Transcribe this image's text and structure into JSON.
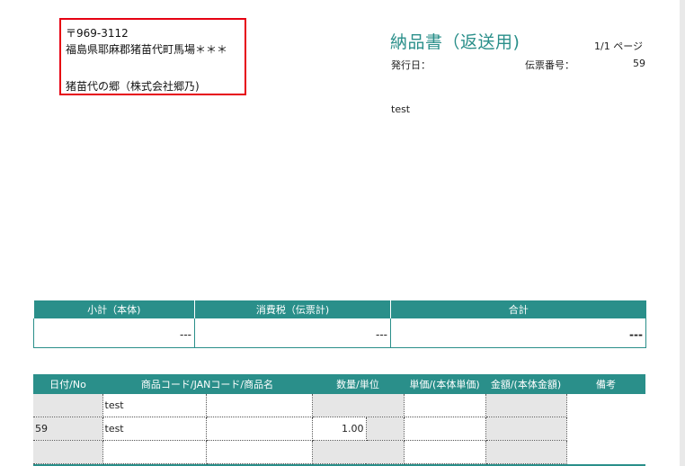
{
  "sender": {
    "postal": "〒969-3112",
    "address": "福島県耶麻郡猪苗代町馬場＊＊＊",
    "company": "猪苗代の郷（株式会社郷乃)"
  },
  "doc": {
    "title": "納品書（返送用)",
    "page_indicator": "1/1 ページ",
    "issue_date_label": "発行日：",
    "issue_date_value": "",
    "slip_number_label": "伝票番号：",
    "slip_number_value": "59",
    "note": "test"
  },
  "summary": {
    "headers": [
      "小計（本体)",
      "消費税（伝票計)",
      "合計"
    ],
    "values": [
      "---",
      "---",
      "---"
    ]
  },
  "items": {
    "headers": [
      "日付/No",
      "商品コード/JANコード/商品名",
      "数量/単位",
      "単価/(本体単価)",
      "金額/(本体金額)",
      "備考"
    ],
    "rows": [
      {
        "date_no": "",
        "code": "test",
        "name": "",
        "qty": "",
        "unit": "",
        "price": "",
        "amount": ""
      },
      {
        "date_no": "59",
        "code": "test",
        "name": "",
        "qty": "1.00",
        "unit": "",
        "price": "",
        "amount": ""
      },
      {
        "date_no": "",
        "code": "",
        "name": "",
        "qty": "",
        "unit": "",
        "price": "",
        "amount": ""
      }
    ]
  },
  "colors": {
    "accent": "#2a8f8a",
    "highlight_border": "#e60012"
  }
}
